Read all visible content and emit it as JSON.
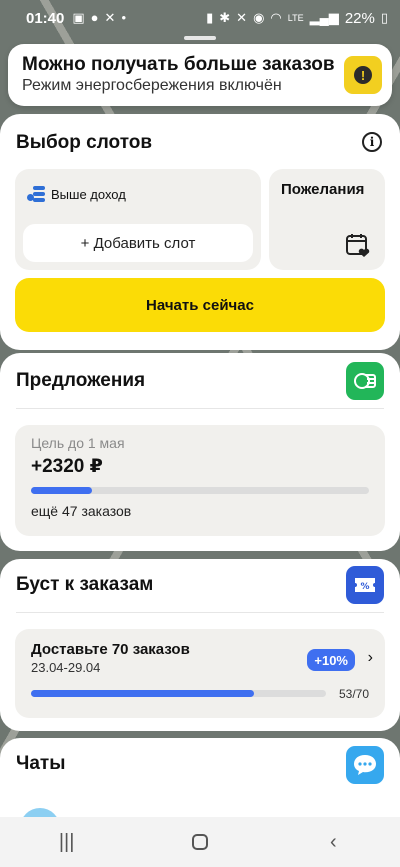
{
  "status_bar": {
    "time": "01:40",
    "battery": "22%",
    "network": "LTE"
  },
  "notice": {
    "title": "Можно получать больше заказов",
    "subtitle": "Режим энергосбережения включён",
    "icon": "warning-icon"
  },
  "slots": {
    "title": "Выбор слотов",
    "higher_income_label": "Выше доход",
    "add_slot_label": "+ Добавить слот",
    "wishes_label": "Пожелания",
    "start_button_label": "Начать сейчас"
  },
  "offers": {
    "title": "Предложения",
    "goal_label": "Цель до 1 мая",
    "goal_amount": "+2320 ₽",
    "goal_progress": 0.18,
    "goal_remaining": "ещё 47 заказов"
  },
  "boost": {
    "title": "Буст к заказам",
    "task_title": "Доставьте 70 заказов",
    "task_dates": "23.04-29.04",
    "badge": "+10%",
    "count": "53/70",
    "progress": 0.757
  },
  "chats": {
    "title": "Чаты"
  },
  "colors": {
    "accent_yellow": "#fbdc06",
    "progress_blue": "#3f6ff0",
    "offers_green": "#22b659",
    "chats_blue": "#36a8ee"
  }
}
